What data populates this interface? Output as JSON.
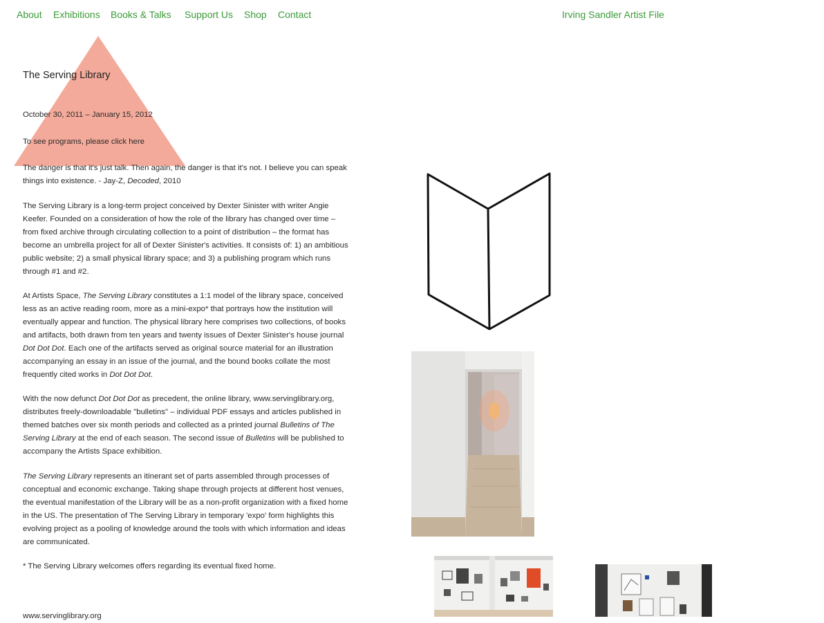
{
  "nav": {
    "about": "About",
    "exhibitions": "Exhibitions",
    "books_talks": "Books & Talks",
    "support": "Support Us",
    "shop": "Shop",
    "contact": "Contact",
    "artist_file": "Irving Sandler Artist File"
  },
  "exhibition": {
    "title": "The Serving Library",
    "dates": "October 30, 2011 – January 15, 2012",
    "programs_link": "To see programs, please click here"
  },
  "body": {
    "quote": {
      "text": "The danger is that it's just talk. Then again, the danger is that it's not. I believe you can speak things into existence. - Jay-Z, ",
      "book": "Decoded",
      "year": ", 2010"
    },
    "p1": "The Serving Library is a long-term project conceived by Dexter Sinister with writer Angie Keefer. Founded on a consideration of how the role of the library has changed over time – from fixed archive through circulating collection to a point of distribution – the format has become an umbrella project for all of Dexter Sinister's activities. It consists of: 1) an ambitious public website; 2) a small physical library space; and 3) a publishing program which runs through #1 and #2.",
    "p2": {
      "a": "At Artists Space, ",
      "b": "The Serving Library",
      "c": " constitutes a 1:1 model of the library space, conceived less as an active reading room, more as a mini-expo* that portrays how the institution will eventually appear and function. The physical library here comprises two collections, of books and artifacts, both drawn from ten years and twenty issues of Dexter Sinister's house journal ",
      "d": "Dot Dot Dot",
      "e": ". Each one of the artifacts served as original source material for an illustration accompanying an essay in an issue of the journal, and the bound books collate the most frequently cited works in ",
      "f": "Dot Dot Dot",
      "g": "."
    },
    "p3": {
      "a": "With the now defunct ",
      "b": "Dot Dot Dot",
      "c": " as precedent, the online library, www.servinglibrary.org, distributes freely-downloadable \"bulletins\" – individual PDF essays and articles published in themed batches over six month periods and collected as a printed journal ",
      "d": "Bulletins of The Serving Library",
      "e": " at the end of each season. The second issue of ",
      "f": "Bulletins",
      "g": " will be published to accompany the Artists Space exhibition."
    },
    "p4": {
      "a": "The Serving Library",
      "b": " represents an itinerant set of parts assembled through processes of conceptual and economic exchange. Taking shape through projects at different host venues, the eventual manifestation of the Library will be as a non-profit organization with a fixed home in the US. The presentation of The Serving Library in temporary 'expo' form highlights this evolving project as a pooling of knowledge around the tools with which information and ideas are communicated."
    },
    "p5": "* The Serving Library welcomes offers regarding its eventual fixed home.",
    "footer_url": "www.servinglibrary.org"
  },
  "colors": {
    "nav_link": "#3a9a37",
    "triangle": "#f2a18f",
    "text": "#2a2a2a"
  }
}
